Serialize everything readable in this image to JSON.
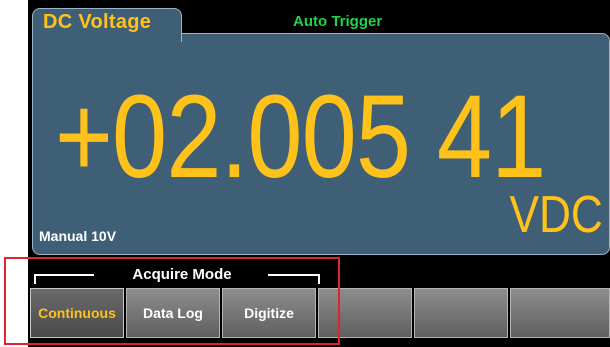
{
  "header": {
    "measurement_tab": "DC Voltage",
    "trigger_mode": "Auto Trigger"
  },
  "display": {
    "reading": "+02.005 41",
    "units": "VDC",
    "range": "Manual 10V"
  },
  "softkey_group": {
    "label": "Acquire Mode"
  },
  "softkeys": [
    {
      "label": "Continuous",
      "active": true
    },
    {
      "label": "Data Log",
      "active": false
    },
    {
      "label": "Digitize",
      "active": false
    },
    {
      "label": "",
      "active": false
    },
    {
      "label": "",
      "active": false
    },
    {
      "label": "",
      "active": false
    }
  ],
  "colors": {
    "reading": "#ffc21a",
    "trigger": "#21d24a",
    "panel": "#3f5f77",
    "annotation_box": "#e0242e"
  }
}
